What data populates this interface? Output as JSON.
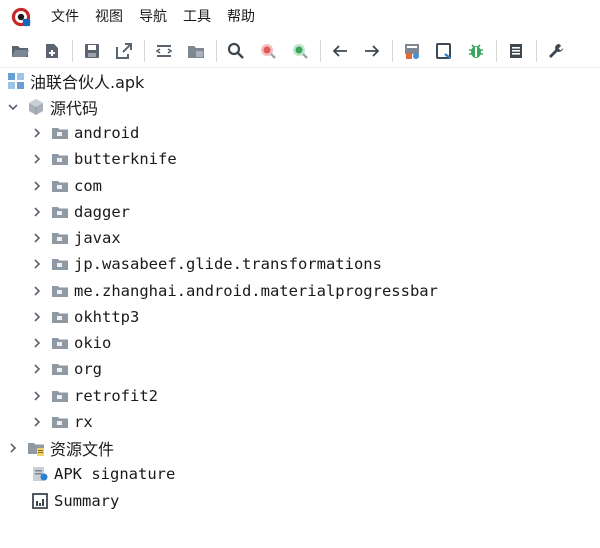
{
  "menu": {
    "items": [
      {
        "label": "文件"
      },
      {
        "label": "视图"
      },
      {
        "label": "导航"
      },
      {
        "label": "工具"
      },
      {
        "label": "帮助"
      }
    ]
  },
  "toolbar": {
    "icons": [
      "open-folder-icon",
      "add-files-icon",
      "save-icon",
      "export-icon",
      "sync-icon",
      "folder-flatten-icon",
      "search-icon",
      "search-class-icon",
      "search-usage-icon",
      "back-arrow-icon",
      "forward-arrow-icon",
      "deobfuscation-icon",
      "log-viewer-icon",
      "debug-bug-icon",
      "summary-icon",
      "settings-wrench-icon"
    ]
  },
  "tree": {
    "root": {
      "label": "油联合伙人.apk"
    },
    "source_code": {
      "label": "源代码"
    },
    "packages": [
      {
        "label": "android"
      },
      {
        "label": "butterknife"
      },
      {
        "label": "com"
      },
      {
        "label": "dagger"
      },
      {
        "label": "javax"
      },
      {
        "label": "jp.wasabeef.glide.transformations"
      },
      {
        "label": "me.zhanghai.android.materialprogressbar"
      },
      {
        "label": "okhttp3"
      },
      {
        "label": "okio"
      },
      {
        "label": "org"
      },
      {
        "label": "retrofit2"
      },
      {
        "label": "rx"
      }
    ],
    "resources": {
      "label": "资源文件"
    },
    "signature": {
      "label": "APK signature"
    },
    "summary": {
      "label": "Summary"
    }
  },
  "colors": {
    "folder": "#8f9aa5",
    "accent_green": "#3aa55d",
    "accent_red": "#d9534f",
    "accent_blue": "#2f7fd1"
  }
}
